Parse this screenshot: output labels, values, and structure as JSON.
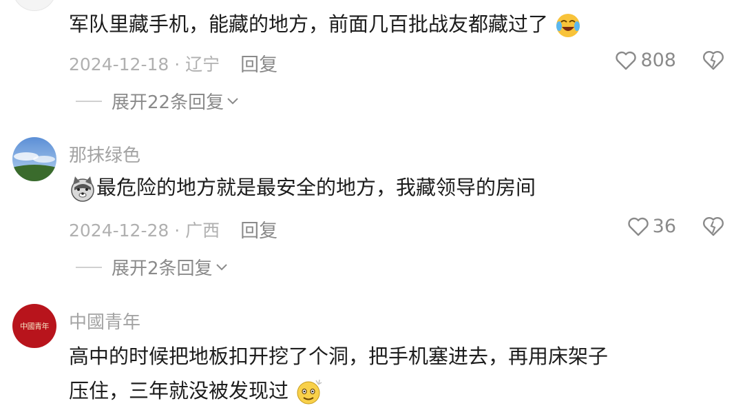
{
  "comments": [
    {
      "text": "军队里藏手机，能藏的地方，前面几百批战友都藏过了",
      "date_loc": "2024-12-18 · 辽宁",
      "reply": "回复",
      "likes": "808",
      "expand": "展开22条回复",
      "emoji": "crying-laughing-emoji"
    },
    {
      "username": "那抹绿色",
      "text": "最危险的地方就是最安全的地方，我藏领导的房间",
      "date_loc": "2024-12-28 · 广西",
      "reply": "回复",
      "likes": "36",
      "expand": "展开2条回复",
      "emoji": "dog-emoji"
    },
    {
      "username": "中國青年",
      "avatar_text": "中國青年",
      "text_line1": "高中的时候把地板扣开挖了个洞，把手机塞进去，再用床架子",
      "text_line2": "压住，三年就没被发现过",
      "emoji": "dizzy-face-emoji"
    }
  ],
  "colors": {
    "meta": "#b0b0b0",
    "text": "#1c1c1c",
    "avatar_red": "#b8141c"
  }
}
